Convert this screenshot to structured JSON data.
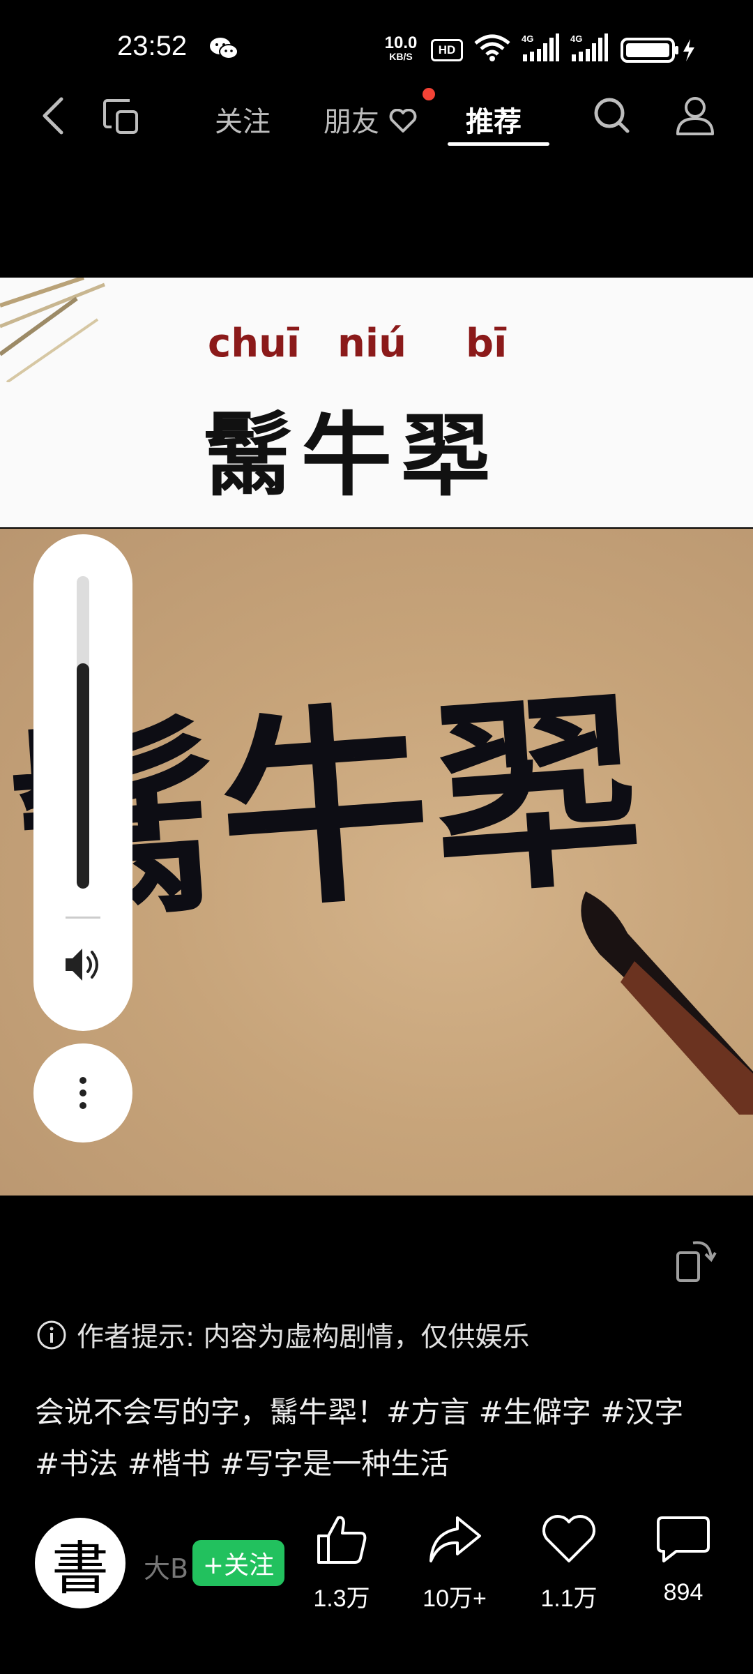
{
  "status_bar": {
    "time": "23:52",
    "net_speed_value": "10.0",
    "net_speed_unit": "KB/S",
    "hd_badge": "HD",
    "signal_1": "4G",
    "signal_2": "4G"
  },
  "nav": {
    "tabs": [
      {
        "label": "关注"
      },
      {
        "label": "朋友"
      },
      {
        "label": "推荐"
      }
    ],
    "active_tab": "推荐",
    "friends_has_notification": true
  },
  "video": {
    "pinyin": [
      "chuī",
      "niú",
      "bī"
    ],
    "title_chars": "鬗牛翆",
    "scene_chars": "鬗牛翆",
    "volume_level": 0.72
  },
  "notice": {
    "text": "作者提示: 内容为虚构剧情，仅供娱乐"
  },
  "caption": {
    "text": "会说不会写的字，鬗牛翆！",
    "hashtags": [
      "#方言",
      "#生僻字",
      "#汉字",
      "#书法",
      "#楷书",
      "#写字是一种生活"
    ]
  },
  "author": {
    "avatar_char": "書",
    "name": "大B",
    "follow_label": "+关注"
  },
  "actions": {
    "likes": "1.3万",
    "shares": "10万+",
    "favorites": "1.1万",
    "comments": "894"
  },
  "colors": {
    "follow_green": "#22c15e",
    "notification_red": "#f44336",
    "pinyin_red": "#8b1a1a"
  }
}
